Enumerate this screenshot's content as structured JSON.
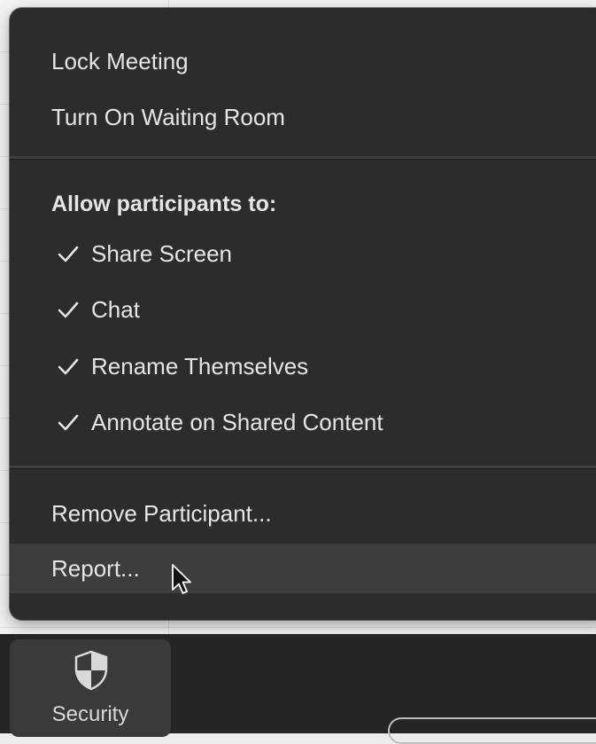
{
  "menu": {
    "lock_meeting": "Lock Meeting",
    "waiting_room": "Turn On Waiting Room",
    "allow_heading": "Allow participants to:",
    "allow_items": [
      {
        "label": "Share Screen",
        "checked": true
      },
      {
        "label": "Chat",
        "checked": true
      },
      {
        "label": "Rename Themselves",
        "checked": true
      },
      {
        "label": "Annotate on Shared Content",
        "checked": true
      }
    ],
    "remove_participant": "Remove Participant...",
    "report": "Report...",
    "hovered_item": "Report..."
  },
  "toolbar": {
    "security_label": "Security",
    "security_icon": "shield-icon"
  },
  "colors": {
    "menu_background": "#2c2c2c",
    "menu_text": "#e6e6e6",
    "hover_background": "#3d3d3d",
    "toolbar_background": "#252525",
    "toolbar_button": "#3a3a3a"
  },
  "icons": {
    "check": "checkmark-icon",
    "cursor": "mouse-pointer-icon"
  }
}
